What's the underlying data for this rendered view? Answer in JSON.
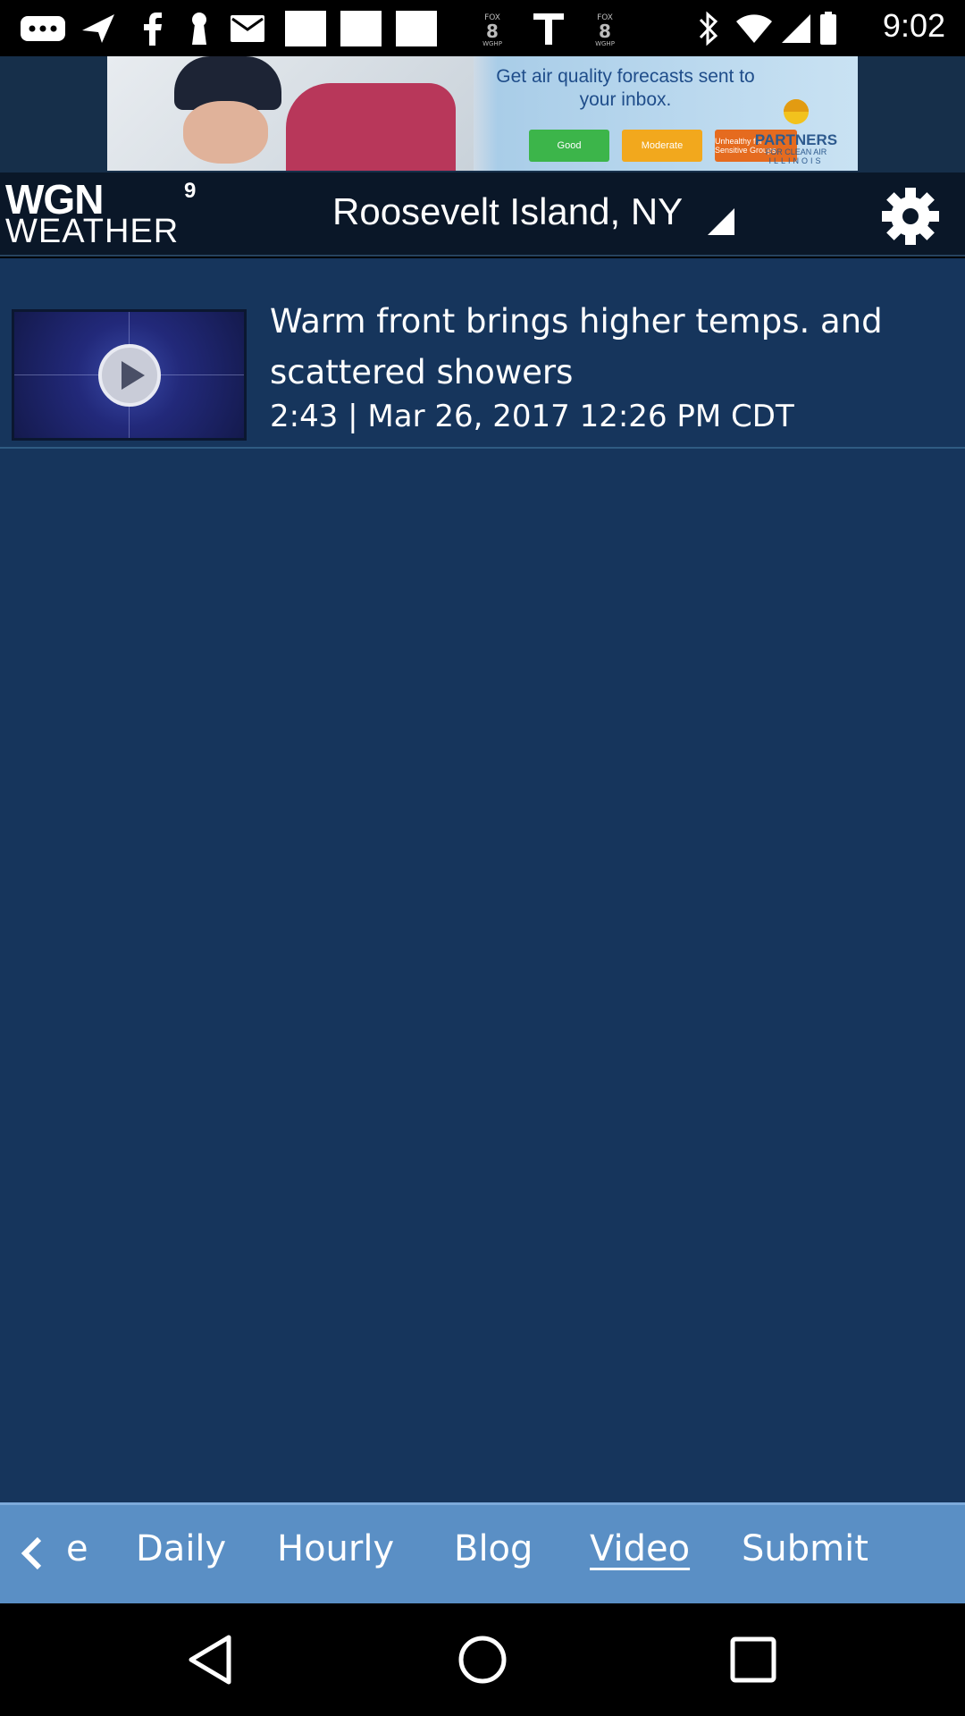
{
  "status_bar": {
    "time": "9:02",
    "icons": [
      "more-icon",
      "navigation-icon",
      "facebook-icon",
      "keyhole-icon",
      "mail-icon",
      "square-icon",
      "square-icon",
      "square-icon",
      "fox8-icon",
      "t-icon",
      "fox8-icon",
      "bluetooth-icon",
      "wifi-icon",
      "signal-icon",
      "battery-icon"
    ]
  },
  "ad": {
    "text": "Get air quality forecasts sent to your inbox.",
    "buttons": [
      "Good",
      "Moderate",
      "Unhealthy for Sensitive Groups"
    ],
    "logo_title": "PARTNERS",
    "logo_sub": "FOR CLEAN AIR",
    "logo_state": "ILLINOIS"
  },
  "header": {
    "logo_top": "WGN",
    "logo_num": "9",
    "logo_bottom": "WEATHER",
    "location": "Roosevelt Island, NY",
    "settings_icon": "gear-icon"
  },
  "videos": [
    {
      "title": "Warm front brings higher temps. and scattered showers",
      "meta": "2:43 | Mar 26, 2017 12:26 PM CDT"
    }
  ],
  "tabs": {
    "partial": "e",
    "daily": "Daily",
    "hourly": "Hourly",
    "blog": "Blog",
    "video": "Video",
    "submit": "Submit",
    "active": "Video"
  },
  "colors": {
    "content_bg": "#16355c",
    "header_bg": "#0a1728",
    "tab_bg": "#5a8fc5"
  }
}
